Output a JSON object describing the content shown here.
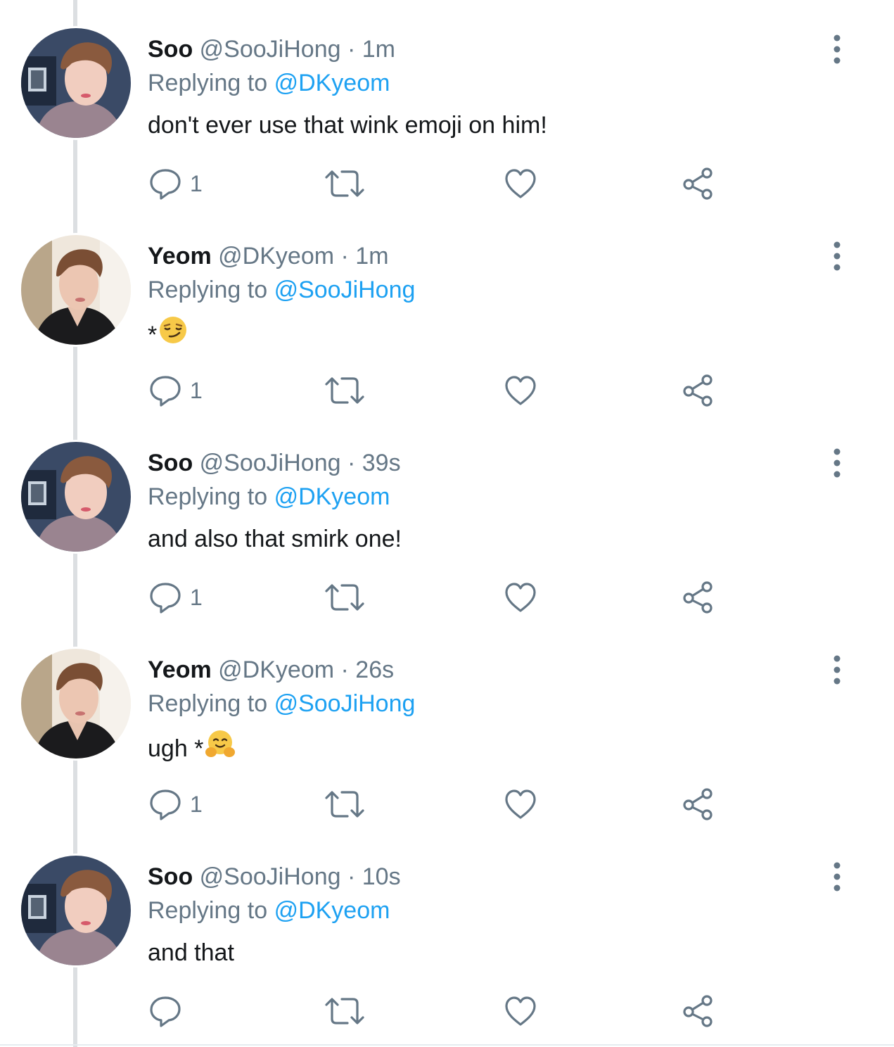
{
  "thread": [
    {
      "avatar": "soo",
      "display_name": "Soo",
      "handle": "@SooJiHong",
      "time": "· 1m",
      "replying_label": "Replying to",
      "replying_to": "@DKyeom",
      "text": "don't ever use that wink emoji on him!",
      "emoji": "",
      "reply_count": "1"
    },
    {
      "avatar": "yeom",
      "display_name": "Yeom",
      "handle": "@DKyeom",
      "time": "· 1m",
      "replying_label": "Replying to",
      "replying_to": "@SooJiHong",
      "text": "*",
      "emoji": "smirking-face",
      "reply_count": "1"
    },
    {
      "avatar": "soo",
      "display_name": "Soo",
      "handle": "@SooJiHong",
      "time": "· 39s",
      "replying_label": "Replying to",
      "replying_to": "@DKyeom",
      "text": "and also that smirk one!",
      "emoji": "",
      "reply_count": "1"
    },
    {
      "avatar": "yeom",
      "display_name": "Yeom",
      "handle": "@DKyeom",
      "time": "· 26s",
      "replying_label": "Replying to",
      "replying_to": "@SooJiHong",
      "text": "ugh *",
      "emoji": "hugging-face",
      "reply_count": "1"
    },
    {
      "avatar": "soo",
      "display_name": "Soo",
      "handle": "@SooJiHong",
      "time": "· 10s",
      "replying_label": "Replying to",
      "replying_to": "@DKyeom",
      "text": "and that",
      "emoji": "",
      "reply_count": ""
    }
  ],
  "icons": {
    "reply": "reply-icon",
    "retweet": "retweet-icon",
    "like": "like-icon",
    "share": "share-icon",
    "more": "more-options-icon"
  },
  "colors": {
    "text": "#14171a",
    "secondary": "#657786",
    "link": "#1da1f2",
    "thread_line": "#dcdfe2"
  }
}
